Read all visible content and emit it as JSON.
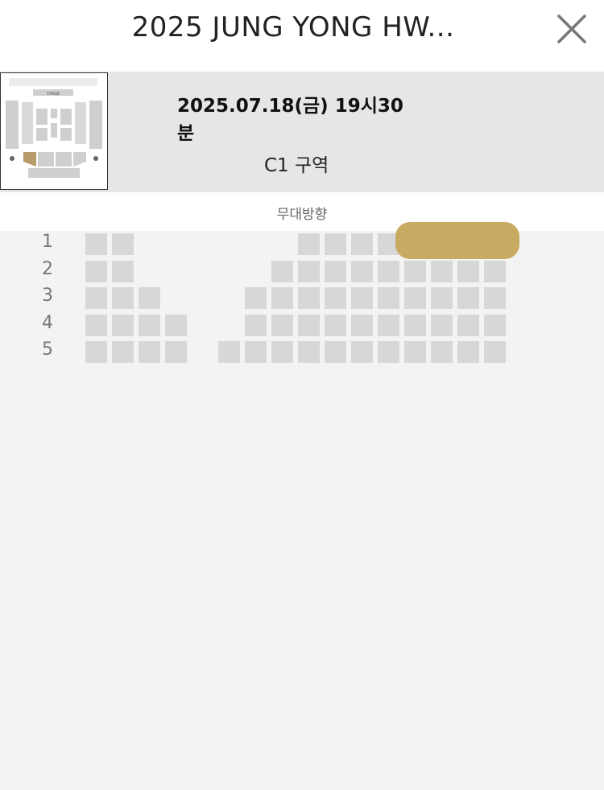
{
  "header": {
    "title": "2025 JUNG YONG HW...",
    "close_icon": "close-icon"
  },
  "event": {
    "datetime": "2025.07.18(금) 19시30분",
    "zone": "C1 구역",
    "seatmap_thumbnail": {
      "stage_label": "STAGE",
      "highlighted_section": "C1"
    }
  },
  "stage_direction": "무대방향",
  "rows": [
    {
      "label": "1",
      "seats": [
        0,
        1,
        8,
        9,
        10,
        11,
        12,
        13,
        14,
        15
      ]
    },
    {
      "label": "2",
      "seats": [
        0,
        1,
        7,
        8,
        9,
        10,
        11,
        12,
        13,
        14,
        15
      ]
    },
    {
      "label": "3",
      "seats": [
        0,
        1,
        2,
        6,
        7,
        8,
        9,
        10,
        11,
        12,
        13,
        14,
        15
      ]
    },
    {
      "label": "4",
      "seats": [
        0,
        1,
        2,
        3,
        6,
        7,
        8,
        9,
        10,
        11,
        12,
        13,
        14,
        15
      ]
    },
    {
      "label": "5",
      "seats": [
        0,
        1,
        2,
        3,
        5,
        6,
        7,
        8,
        9,
        10,
        11,
        12,
        13,
        14,
        15
      ]
    }
  ],
  "colors": {
    "seat_available": "#d7d7d7",
    "seat_selected": "#c8ab62",
    "info_bg": "#e6e6e6",
    "page_bg": "#f3f3f3"
  }
}
